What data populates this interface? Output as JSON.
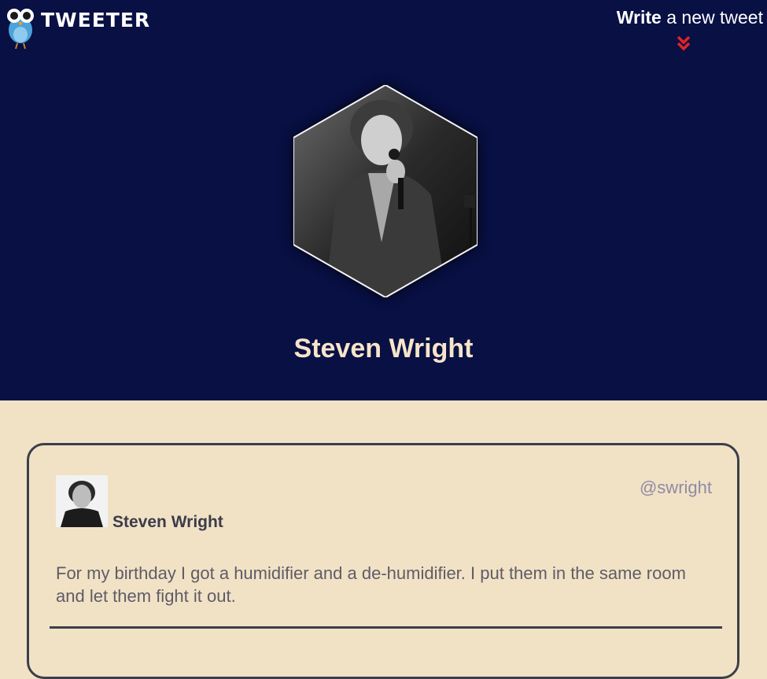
{
  "app": {
    "name": "TWEETER"
  },
  "header": {
    "write_bold": "Write",
    "write_rest": " a new tweet",
    "accent_color": "#e02424"
  },
  "profile": {
    "name": "Steven Wright"
  },
  "tweet": {
    "author": "Steven Wright",
    "handle": "@swright",
    "text": "For my birthday I got a humidifier and a de-humidifier. I put them in the same room and let them fight it out."
  },
  "colors": {
    "header_bg": "#081044",
    "page_bg": "#f1e2c6",
    "name_color": "#f7e4c9"
  },
  "icons": {
    "logo": "owl-bird-logo-icon",
    "chevron": "double-chevron-down-icon"
  }
}
